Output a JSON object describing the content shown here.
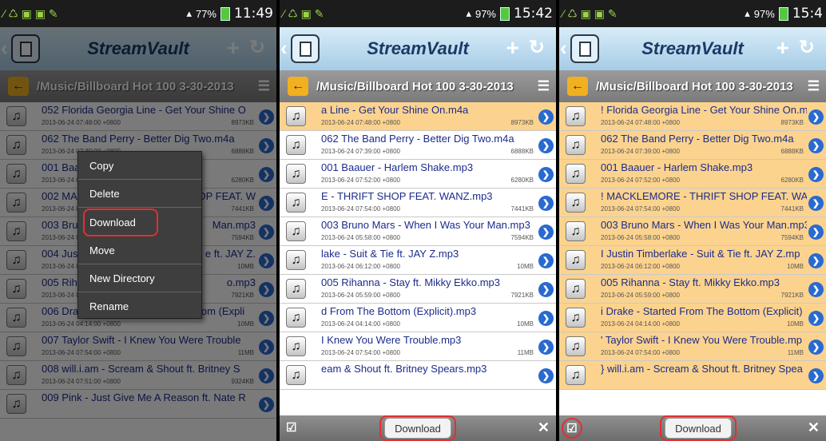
{
  "status": {
    "p1_time": "11:49",
    "p1_battery": "77%",
    "p2_time": "15:42",
    "p2_battery": "97%",
    "p3_time": "15:4",
    "p3_battery": "97%"
  },
  "app_title": "StreamVault",
  "path": "/Music/Billboard Hot 100 3-30-2013",
  "p1_rows": [
    {
      "name": "052 Florida Georgia Line - Get Your Shine O",
      "date": "2013-06-24 07:48:00 +0800",
      "size": "8973KB"
    },
    {
      "name": "062 The Band Perry - Better Dig Two.m4a",
      "date": "2013-06-24 07:39:00 +0800",
      "size": "6888KB"
    },
    {
      "name": "001 Baa",
      "date": "2013-06-24 07:52:00 +0800",
      "size": "6280KB"
    },
    {
      "name": "002 MA",
      "date": "2013-06-24 07:54:00 +0800",
      "size": "7441KB",
      "tail": "OP FEAT. W"
    },
    {
      "name": "003 Brun",
      "date": "2013-06-24 05:58:00 +0800",
      "size": "7594KB",
      "tail": "Man.mp3"
    },
    {
      "name": "004 Jus",
      "date": "2013-06-24 06:12:00 +0800",
      "size": "10MB",
      "tail": "e ft. JAY Z."
    },
    {
      "name": "005 Rih",
      "date": "2013-06-24 05:59:00 +0800",
      "size": "7921KB",
      "tail": "o.mp3"
    },
    {
      "name": "006 Drake - Started From The Bottom (Expli",
      "date": "2013-06-24 04:14:00 +0800",
      "size": "10MB"
    },
    {
      "name": "007 Taylor Swift - I Knew You Were Trouble",
      "date": "2013-06-24 07:54:00 +0800",
      "size": "11MB"
    },
    {
      "name": "008 will.i.am - Scream & Shout ft. Britney S",
      "date": "2013-06-24 07:51:00 +0800",
      "size": "9324KB"
    },
    {
      "name": "009 Pink - Just Give Me A Reason ft. Nate R",
      "date": "",
      "size": ""
    }
  ],
  "context_menu": [
    "Copy",
    "Delete",
    "Download",
    "Move",
    "New Directory",
    "Rename"
  ],
  "p2_rows": [
    {
      "name": "a Line - Get Your Shine On.m4a",
      "date": "2013-06-24 07:48:00 +0800",
      "size": "8973KB",
      "sel": true
    },
    {
      "name": "062 The Band Perry - Better Dig Two.m4a",
      "date": "2013-06-24 07:39:00 +0800",
      "size": "6888KB"
    },
    {
      "name": "001 Baauer - Harlem Shake.mp3",
      "date": "2013-06-24 07:52:00 +0800",
      "size": "6280KB"
    },
    {
      "name": "E - THRIFT SHOP FEAT. WANZ.mp3",
      "date": "2013-06-24 07:54:00 +0800",
      "size": "7441KB"
    },
    {
      "name": "003 Bruno Mars - When I Was Your Man.mp3",
      "date": "2013-06-24 05:58:00 +0800",
      "size": "7594KB"
    },
    {
      "name": "lake - Suit & Tie ft. JAY Z.mp3",
      "date": "2013-06-24 06:12:00 +0800",
      "size": "10MB"
    },
    {
      "name": "005 Rihanna - Stay ft. Mikky Ekko.mp3",
      "date": "2013-06-24 05:59:00 +0800",
      "size": "7921KB"
    },
    {
      "name": "d From The Bottom (Explicit).mp3",
      "date": "2013-06-24 04:14:00 +0800",
      "size": "10MB"
    },
    {
      "name": "I Knew You Were Trouble.mp3",
      "date": "2013-06-24 07:54:00 +0800",
      "size": "11MB"
    },
    {
      "name": "eam & Shout ft. Britney Spears.mp3",
      "date": "",
      "size": ""
    }
  ],
  "p3_rows": [
    {
      "name": "! Florida Georgia Line - Get Your Shine On.m",
      "date": "2013-06-24 07:48:00 +0800",
      "size": "8973KB"
    },
    {
      "name": "062 The Band Perry - Better Dig Two.m4a",
      "date": "2013-06-24 07:39:00 +0800",
      "size": "6888KB"
    },
    {
      "name": "001 Baauer - Harlem Shake.mp3",
      "date": "2013-06-24 07:52:00 +0800",
      "size": "6280KB"
    },
    {
      "name": "! MACKLEMORE - THRIFT SHOP FEAT. WAN",
      "date": "2013-06-24 07:54:00 +0800",
      "size": "7441KB"
    },
    {
      "name": "003 Bruno Mars - When I Was Your Man.mp3",
      "date": "2013-06-24 05:58:00 +0800",
      "size": "7594KB"
    },
    {
      "name": "I Justin Timberlake - Suit & Tie ft. JAY Z.mp",
      "date": "2013-06-24 06:12:00 +0800",
      "size": "10MB"
    },
    {
      "name": "005 Rihanna - Stay ft. Mikky Ekko.mp3",
      "date": "2013-06-24 05:59:00 +0800",
      "size": "7921KB"
    },
    {
      "name": "i Drake - Started From The Bottom (Explicit)",
      "date": "2013-06-24 04:14:00 +0800",
      "size": "10MB"
    },
    {
      "name": "' Taylor Swift - I Knew You Were Trouble.mp",
      "date": "2013-06-24 07:54:00 +0800",
      "size": "11MB"
    },
    {
      "name": "} will.i.am - Scream & Shout ft. Britney Spea",
      "date": "",
      "size": ""
    }
  ],
  "bottom": {
    "download_label": "Download"
  },
  "colors": {
    "selected_row": "#fbd38e",
    "highlight": "#e03030",
    "file_name": "#1c2c8c"
  }
}
